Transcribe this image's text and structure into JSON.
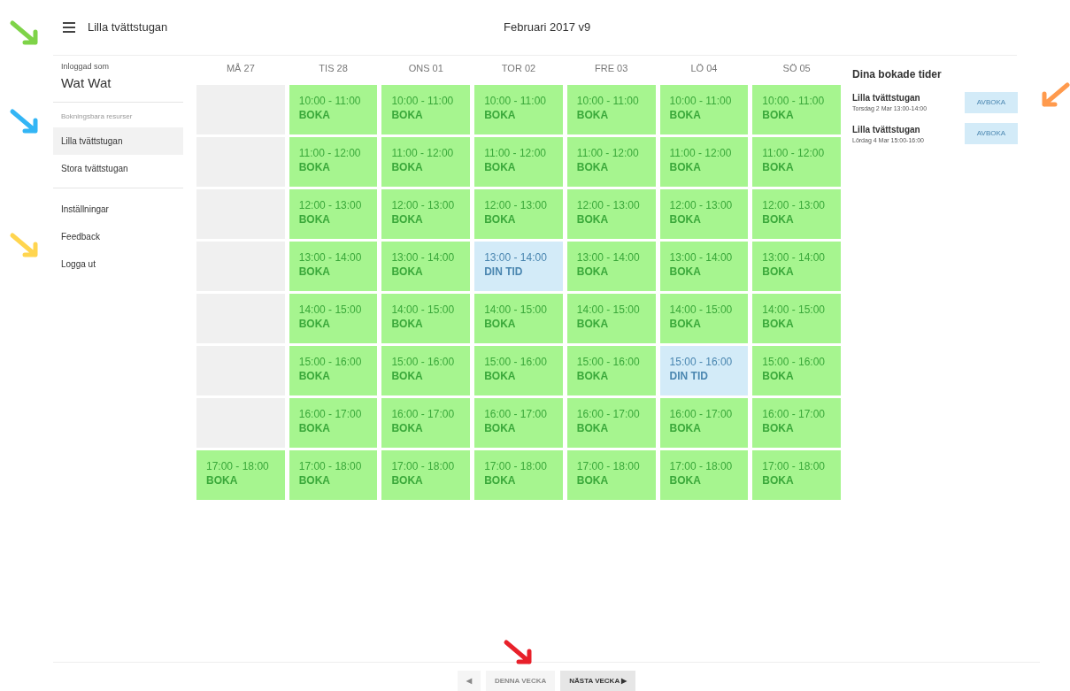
{
  "header": {
    "title": "Lilla tvättstugan",
    "week": "Februari 2017 v9"
  },
  "sidebar": {
    "logged_in_label": "Inloggad som",
    "user": "Wat Wat",
    "resources_label": "Bokningsbara resurser",
    "resources": [
      {
        "label": "Lilla tvättstugan",
        "selected": true
      },
      {
        "label": "Stora tvättstugan",
        "selected": false
      }
    ],
    "links": [
      "Inställningar",
      "Feedback",
      "Logga ut"
    ]
  },
  "calendar": {
    "days": [
      {
        "label": "MÅ 27",
        "slots": [
          {
            "kind": "empty"
          },
          {
            "kind": "empty"
          },
          {
            "kind": "empty"
          },
          {
            "kind": "empty"
          },
          {
            "kind": "empty"
          },
          {
            "kind": "empty"
          },
          {
            "kind": "empty"
          },
          {
            "kind": "free",
            "time": "17:00 - 18:00",
            "action": "BOKA"
          }
        ]
      },
      {
        "label": "TIS 28",
        "slots": [
          {
            "kind": "free",
            "time": "10:00 - 11:00",
            "action": "BOKA"
          },
          {
            "kind": "free",
            "time": "11:00 - 12:00",
            "action": "BOKA"
          },
          {
            "kind": "free",
            "time": "12:00 - 13:00",
            "action": "BOKA"
          },
          {
            "kind": "free",
            "time": "13:00 - 14:00",
            "action": "BOKA"
          },
          {
            "kind": "free",
            "time": "14:00 - 15:00",
            "action": "BOKA"
          },
          {
            "kind": "free",
            "time": "15:00 - 16:00",
            "action": "BOKA"
          },
          {
            "kind": "free",
            "time": "16:00 - 17:00",
            "action": "BOKA"
          },
          {
            "kind": "free",
            "time": "17:00 - 18:00",
            "action": "BOKA"
          }
        ]
      },
      {
        "label": "ONS 01",
        "slots": [
          {
            "kind": "free",
            "time": "10:00 - 11:00",
            "action": "BOKA"
          },
          {
            "kind": "free",
            "time": "11:00 - 12:00",
            "action": "BOKA"
          },
          {
            "kind": "free",
            "time": "12:00 - 13:00",
            "action": "BOKA"
          },
          {
            "kind": "free",
            "time": "13:00 - 14:00",
            "action": "BOKA"
          },
          {
            "kind": "free",
            "time": "14:00 - 15:00",
            "action": "BOKA"
          },
          {
            "kind": "free",
            "time": "15:00 - 16:00",
            "action": "BOKA"
          },
          {
            "kind": "free",
            "time": "16:00 - 17:00",
            "action": "BOKA"
          },
          {
            "kind": "free",
            "time": "17:00 - 18:00",
            "action": "BOKA"
          }
        ]
      },
      {
        "label": "TOR 02",
        "slots": [
          {
            "kind": "free",
            "time": "10:00 - 11:00",
            "action": "BOKA"
          },
          {
            "kind": "free",
            "time": "11:00 - 12:00",
            "action": "BOKA"
          },
          {
            "kind": "free",
            "time": "12:00 - 13:00",
            "action": "BOKA"
          },
          {
            "kind": "booked",
            "time": "13:00 - 14:00",
            "action": "DIN TID"
          },
          {
            "kind": "free",
            "time": "14:00 - 15:00",
            "action": "BOKA"
          },
          {
            "kind": "free",
            "time": "15:00 - 16:00",
            "action": "BOKA"
          },
          {
            "kind": "free",
            "time": "16:00 - 17:00",
            "action": "BOKA"
          },
          {
            "kind": "free",
            "time": "17:00 - 18:00",
            "action": "BOKA"
          }
        ]
      },
      {
        "label": "FRE 03",
        "slots": [
          {
            "kind": "free",
            "time": "10:00 - 11:00",
            "action": "BOKA"
          },
          {
            "kind": "free",
            "time": "11:00 - 12:00",
            "action": "BOKA"
          },
          {
            "kind": "free",
            "time": "12:00 - 13:00",
            "action": "BOKA"
          },
          {
            "kind": "free",
            "time": "13:00 - 14:00",
            "action": "BOKA"
          },
          {
            "kind": "free",
            "time": "14:00 - 15:00",
            "action": "BOKA"
          },
          {
            "kind": "free",
            "time": "15:00 - 16:00",
            "action": "BOKA"
          },
          {
            "kind": "free",
            "time": "16:00 - 17:00",
            "action": "BOKA"
          },
          {
            "kind": "free",
            "time": "17:00 - 18:00",
            "action": "BOKA"
          }
        ]
      },
      {
        "label": "LÖ 04",
        "slots": [
          {
            "kind": "free",
            "time": "10:00 - 11:00",
            "action": "BOKA"
          },
          {
            "kind": "free",
            "time": "11:00 - 12:00",
            "action": "BOKA"
          },
          {
            "kind": "free",
            "time": "12:00 - 13:00",
            "action": "BOKA"
          },
          {
            "kind": "free",
            "time": "13:00 - 14:00",
            "action": "BOKA"
          },
          {
            "kind": "free",
            "time": "14:00 - 15:00",
            "action": "BOKA"
          },
          {
            "kind": "booked",
            "time": "15:00 - 16:00",
            "action": "DIN TID"
          },
          {
            "kind": "free",
            "time": "16:00 - 17:00",
            "action": "BOKA"
          },
          {
            "kind": "free",
            "time": "17:00 - 18:00",
            "action": "BOKA"
          }
        ]
      },
      {
        "label": "SÖ 05",
        "slots": [
          {
            "kind": "free",
            "time": "10:00 - 11:00",
            "action": "BOKA"
          },
          {
            "kind": "free",
            "time": "11:00 - 12:00",
            "action": "BOKA"
          },
          {
            "kind": "free",
            "time": "12:00 - 13:00",
            "action": "BOKA"
          },
          {
            "kind": "free",
            "time": "13:00 - 14:00",
            "action": "BOKA"
          },
          {
            "kind": "free",
            "time": "14:00 - 15:00",
            "action": "BOKA"
          },
          {
            "kind": "free",
            "time": "15:00 - 16:00",
            "action": "BOKA"
          },
          {
            "kind": "free",
            "time": "16:00 - 17:00",
            "action": "BOKA"
          },
          {
            "kind": "free",
            "time": "17:00 - 18:00",
            "action": "BOKA"
          }
        ]
      }
    ]
  },
  "bookings": {
    "title": "Dina bokade tider",
    "items": [
      {
        "resource": "Lilla tvättstugan",
        "when": "Torsdag 2 Mar 13:00-14:00",
        "button": "AVBOKA"
      },
      {
        "resource": "Lilla tvättstugan",
        "when": "Lördag 4 Mar 15:00-16:00",
        "button": "AVBOKA"
      }
    ]
  },
  "pager": [
    {
      "label": "◀",
      "disabled": true
    },
    {
      "label": "DENNA VECKA",
      "disabled": true
    },
    {
      "label": "NÄSTA VECKA ▶",
      "disabled": false
    }
  ],
  "annotations": [
    {
      "kind": "down-right",
      "color": "#7ed348"
    },
    {
      "kind": "down-right",
      "color": "#33b5f5"
    },
    {
      "kind": "down-right",
      "color": "#ffd54f"
    },
    {
      "kind": "down-left",
      "color": "#ff9a4d"
    },
    {
      "kind": "down-right",
      "color": "#e8202a"
    }
  ]
}
